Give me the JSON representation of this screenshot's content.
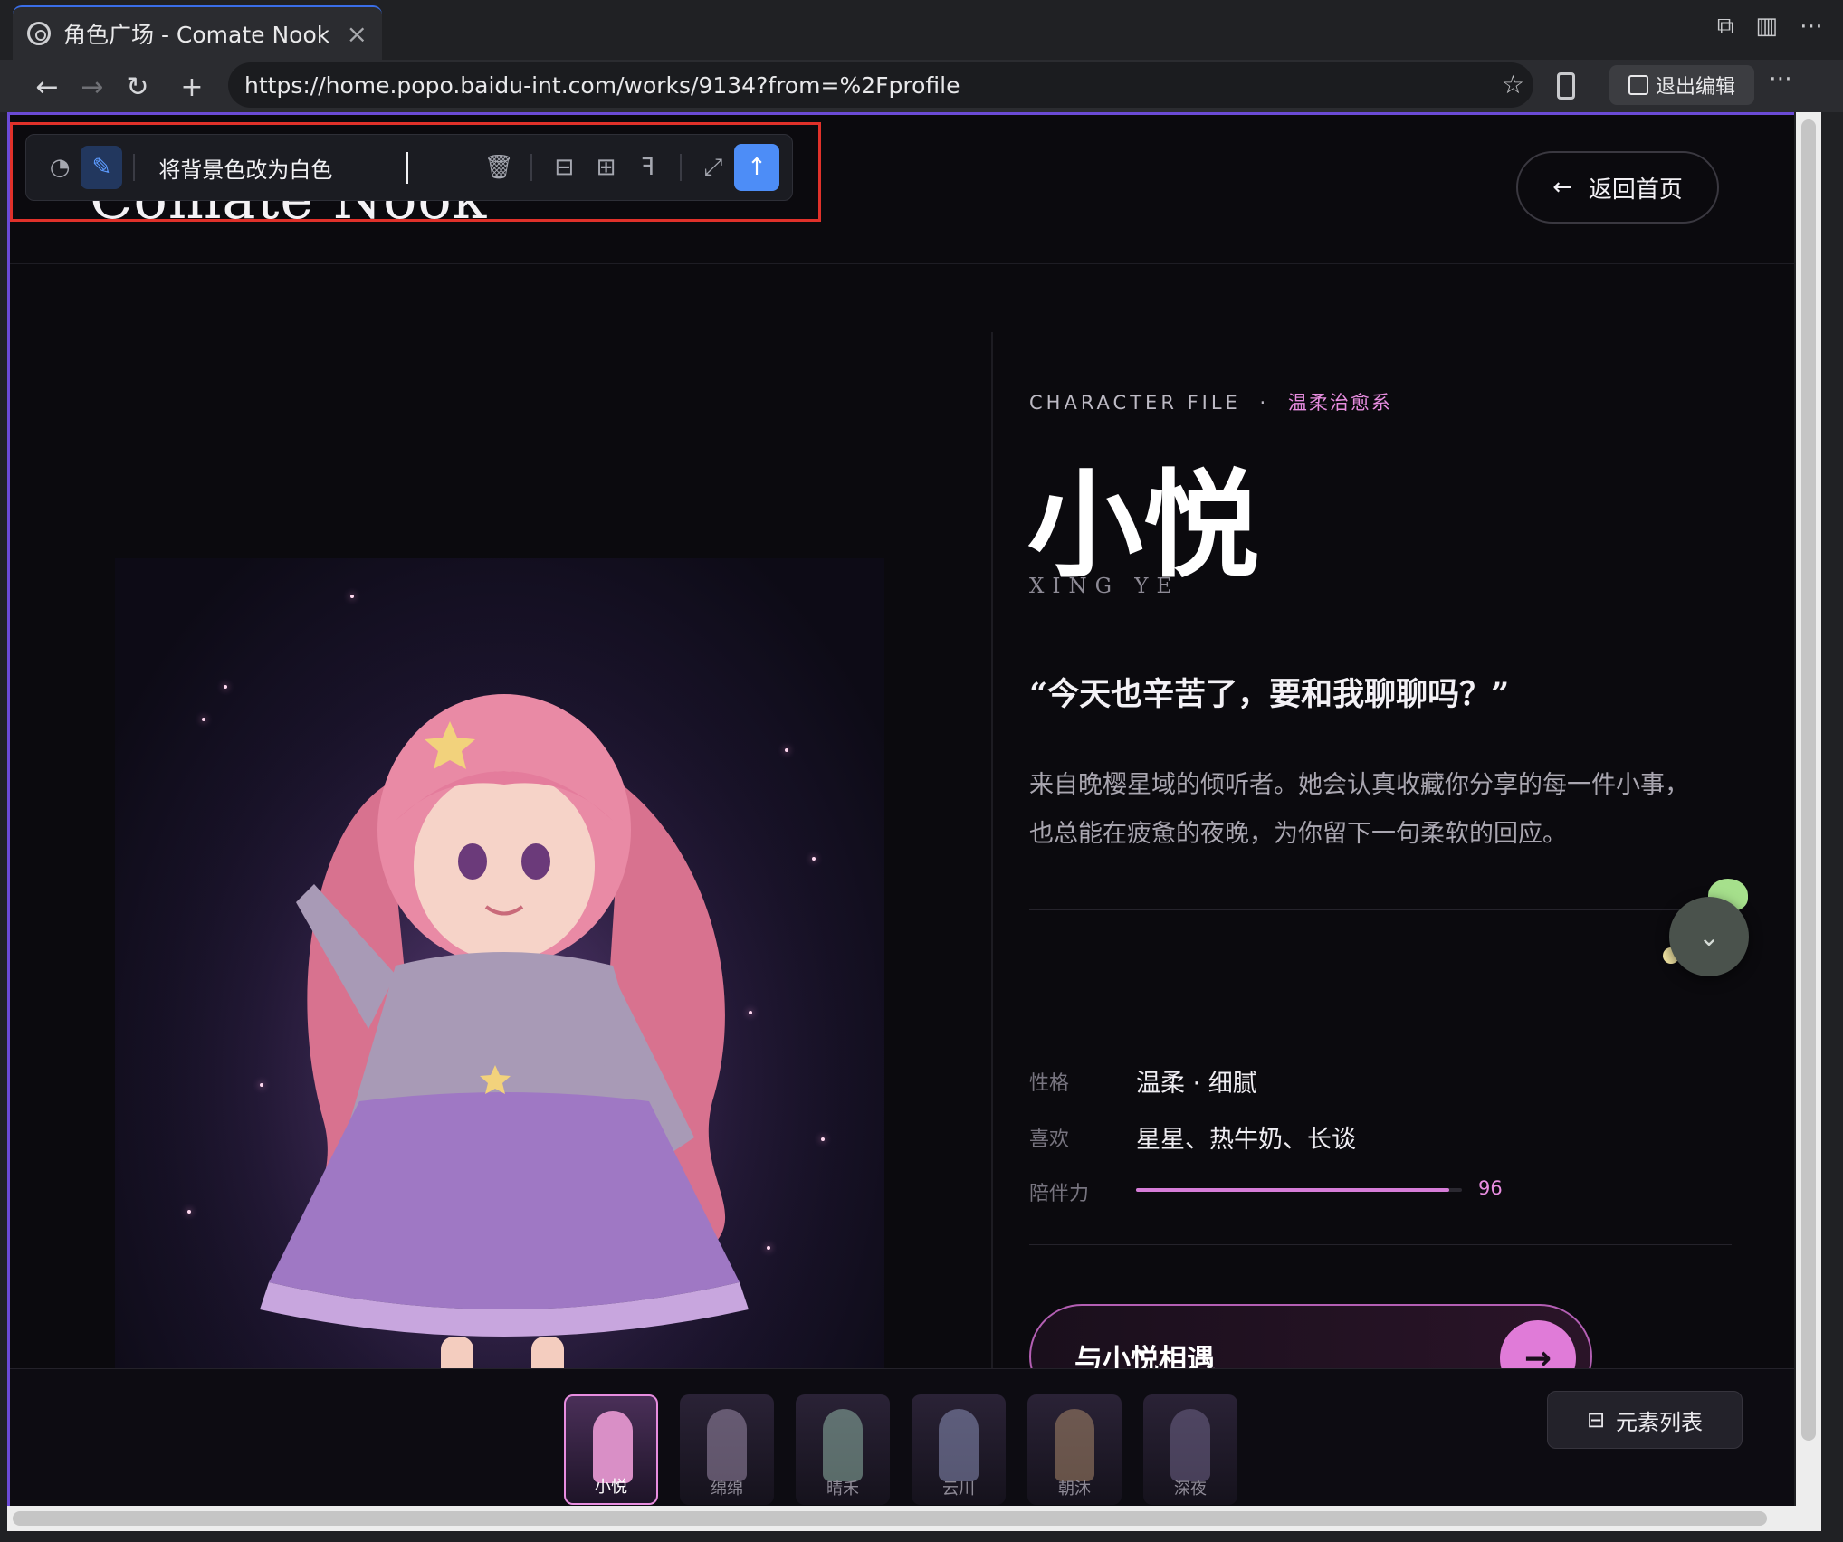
{
  "browser": {
    "tab_title": "角色广场 - Comate Nook",
    "tab_close": "×",
    "url": "https://home.popo.baidu-int.com/works/9134?from=%2Fprofile",
    "exit_edit_label": "退出编辑"
  },
  "edit_toolbar": {
    "prompt_text": "将背景色改为白色"
  },
  "site": {
    "logo": "Comate Nook",
    "back_label": "返回首页"
  },
  "character": {
    "file_tag": "CHARACTER FILE",
    "tag_sep": "·",
    "category": "温柔治愈系",
    "name": "小悦",
    "pinyin": "XING YE",
    "quote": "“今天也辛苦了，要和我聊聊吗？”",
    "description_line1": "来自晚樱星域的倾听者。她会认真收藏你分享的每一件小事，",
    "description_line2": "也总能在疲惫的夜晚，为你留下一句柔软的回应。",
    "attributes": {
      "personality_label": "性格",
      "personality_value": "温柔 · 细腻",
      "likes_label": "喜欢",
      "likes_value": "星星、热牛奶、长谈",
      "companionship_label": "陪伴力",
      "companionship_value": "96",
      "companionship_percent": 96
    },
    "meet_button": "与小悦相遇"
  },
  "strip": {
    "thumbnails": [
      {
        "label": "小悦",
        "active": true,
        "color": "#d98fc6"
      },
      {
        "label": "绵绵",
        "active": false,
        "color": "#9a8aa8"
      },
      {
        "label": "晴禾",
        "active": false,
        "color": "#8fb5a6"
      },
      {
        "label": "云川",
        "active": false,
        "color": "#8a90b8"
      },
      {
        "label": "朝沐",
        "active": false,
        "color": "#a8866a"
      },
      {
        "label": "深夜",
        "active": false,
        "color": "#6f6488"
      }
    ],
    "element_list_label": "元素列表"
  },
  "colors": {
    "accent_pink": "#e88de0",
    "page_bg": "#0b0a0e",
    "send_blue": "#4d8df7"
  }
}
